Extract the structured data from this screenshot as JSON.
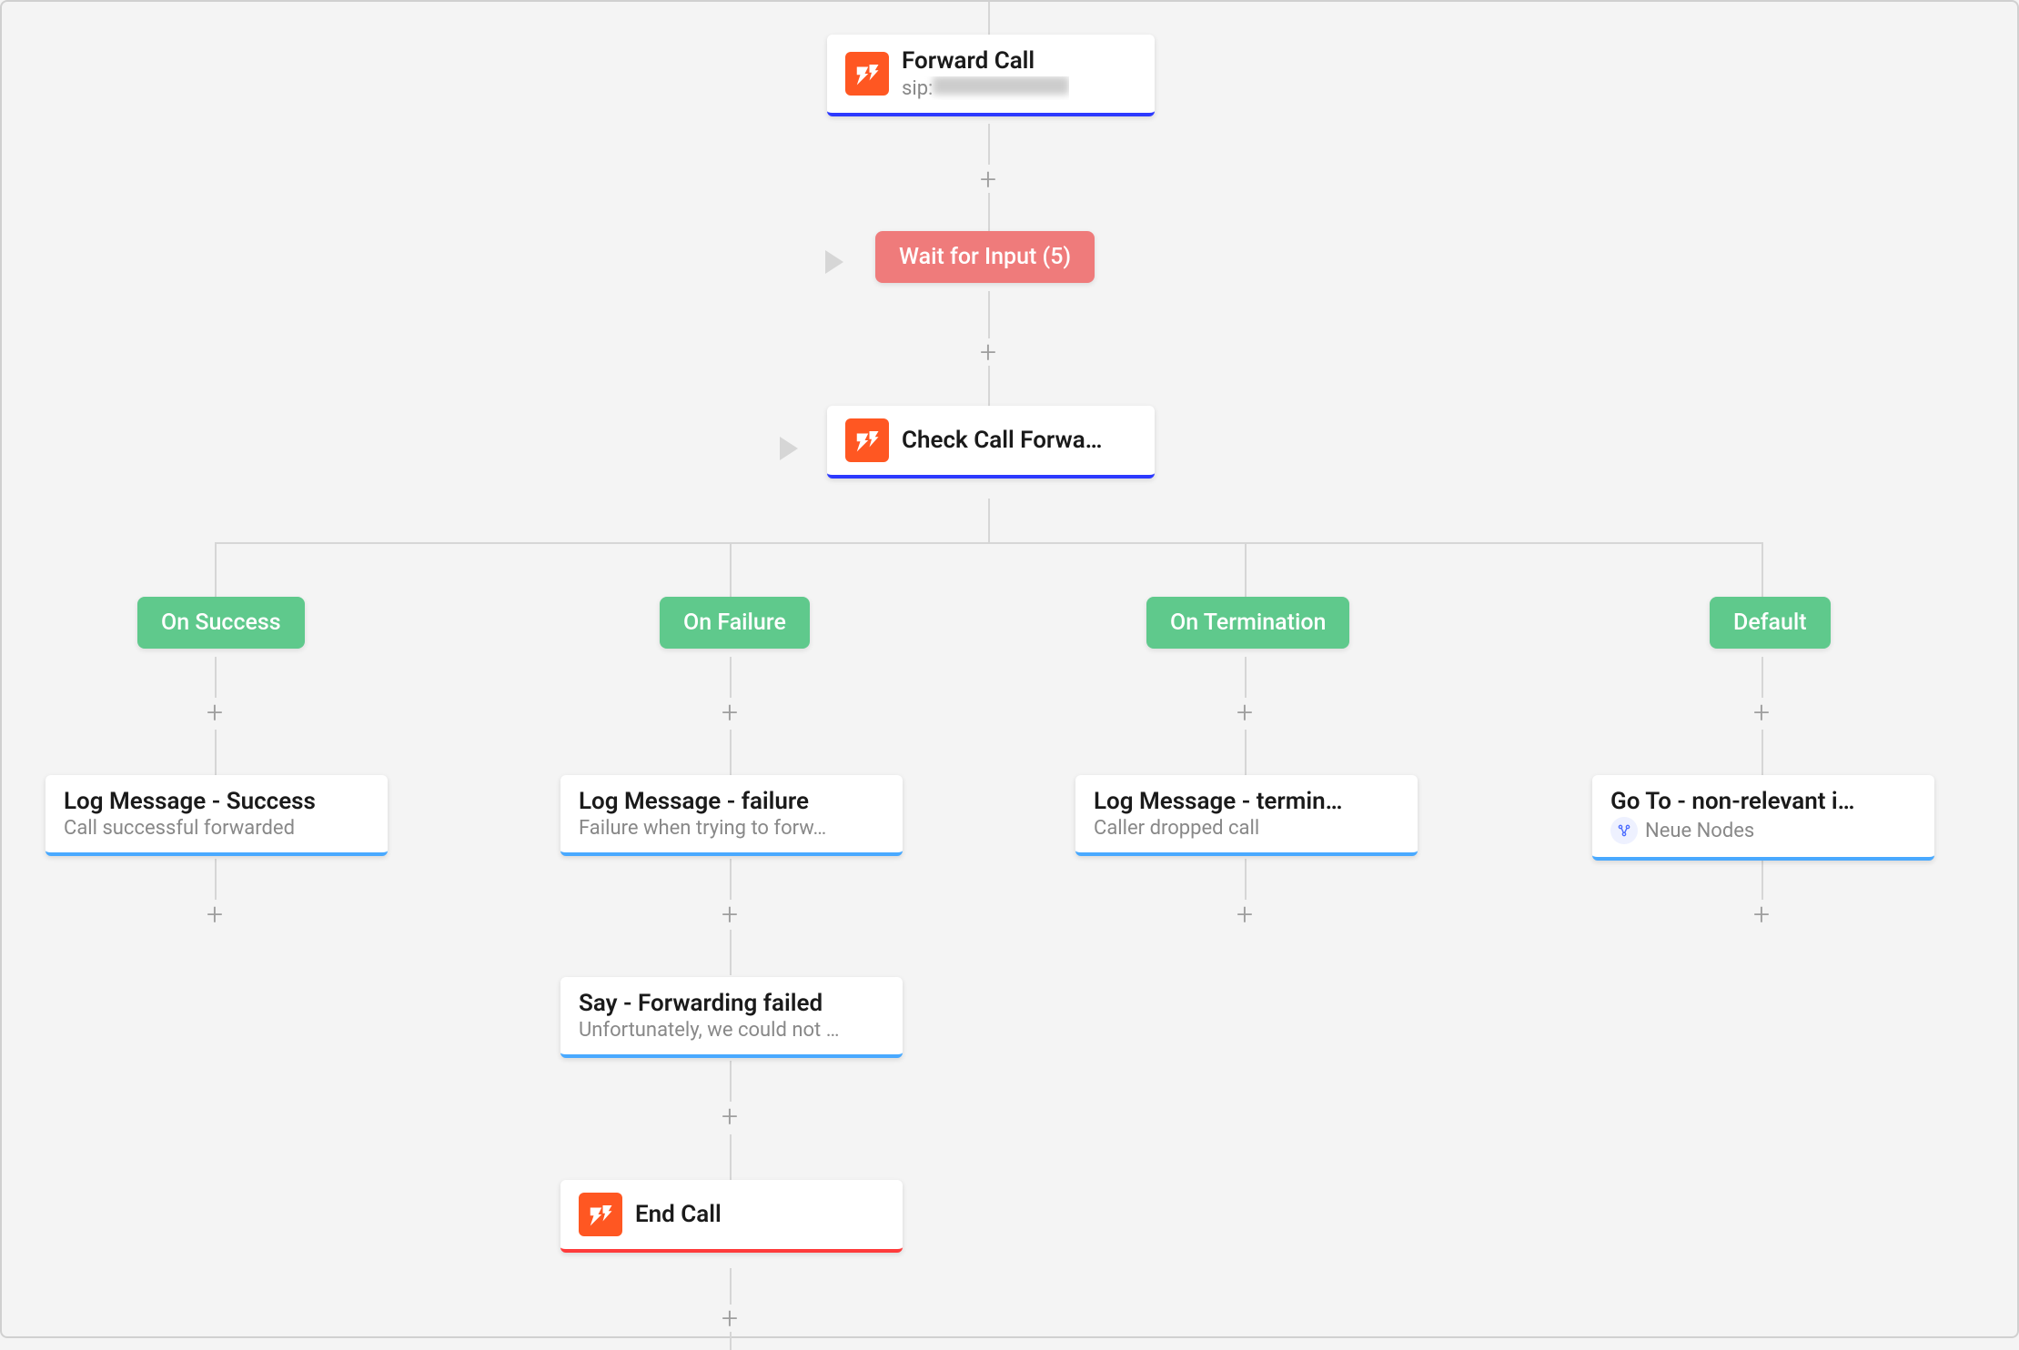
{
  "colors": {
    "accent_blue": "#2c39ff",
    "accent_sky": "#49a9ff",
    "accent_red": "#ff3b3b",
    "chip_red": "#ef7b7b",
    "chip_green": "#5fc98c",
    "icon_orange": "#ff5722"
  },
  "nodes": {
    "forward_call": {
      "title": "Forward Call",
      "subtitle_prefix": "sip:",
      "subtitle_hidden": "██████████"
    },
    "wait_input": {
      "label": "Wait for Input (5)"
    },
    "check_call": {
      "title": "Check Call Forwa…"
    },
    "branches": {
      "on_success": {
        "label": "On Success"
      },
      "on_failure": {
        "label": "On Failure"
      },
      "on_termination": {
        "label": "On Termination"
      },
      "default": {
        "label": "Default"
      }
    },
    "log_success": {
      "title": "Log Message - Success",
      "subtitle": "Call successful forwarded"
    },
    "log_failure": {
      "title": "Log Message - failure",
      "subtitle": "Failure when trying to forw…"
    },
    "log_termination": {
      "title": "Log Message - termin…",
      "subtitle": "Caller dropped call"
    },
    "goto_nonrelevant": {
      "title": "Go To - non-relevant i…",
      "subtitle": "Neue Nodes"
    },
    "say_failed": {
      "title": "Say - Forwarding failed",
      "subtitle": "Unfortunately, we could not …"
    },
    "end_call": {
      "title": "End Call"
    }
  }
}
